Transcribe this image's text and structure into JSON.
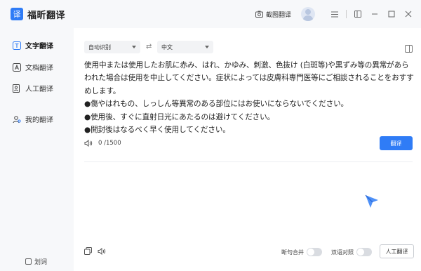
{
  "app": {
    "logo_glyph": "译",
    "title": "福昕翻译",
    "accent_color": "#2f7cf6"
  },
  "topbar": {
    "screenshot_label": "截图翻译",
    "icons": [
      "camera-icon",
      "avatar",
      "menu-icon",
      "minimize-to-tray-icon",
      "minimize-icon",
      "maximize-icon",
      "close-icon"
    ]
  },
  "sidebar": {
    "items": [
      {
        "label": "文字翻译",
        "icon": "text-translate-icon",
        "active": true
      },
      {
        "label": "文档翻译",
        "icon": "document-translate-icon",
        "active": false
      },
      {
        "label": "人工翻译",
        "icon": "human-translate-icon",
        "active": false
      },
      {
        "label": "我的翻译",
        "icon": "my-translations-icon",
        "active": false
      }
    ],
    "note_label": "划词"
  },
  "main": {
    "source_lang": "自动识别",
    "target_lang": "中文",
    "swap_glyph": "⇄",
    "source_text": [
      "使用中または使用したお肌に赤み、はれ、かゆみ、刺激、色抜け (白斑等)や黒ずみ等の異常があらわれた場合は使用を中止してください。症状によっては皮膚科専門医等にご相談されることをおすすめします。",
      "●傷やはれもの、しっしん等異常のある部位にはお使いにならないでください。",
      "●使用後、すぐに直射日光にあたるのは避けてください。",
      "●開封後はなるべく早く使用してください。"
    ],
    "char_count": "0 /1500",
    "translate_label": "翻译",
    "sentence_merge_label": "断句合并",
    "bilingual_label": "双语对照",
    "human_translate_label": "人工翻译"
  }
}
